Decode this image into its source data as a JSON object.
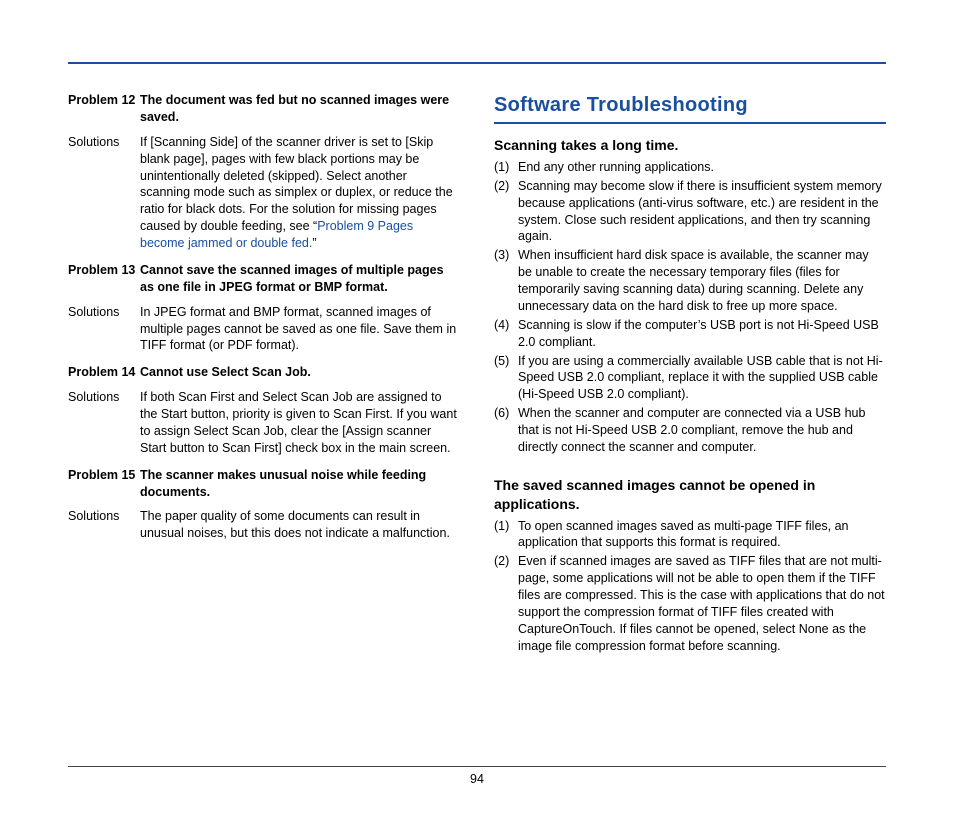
{
  "page_number": "94",
  "left": {
    "items": [
      {
        "label": "Problem 12",
        "title": "The document was fed but no scanned images were saved.",
        "sol_label": "Solutions",
        "sol_pre": "If [Scanning Side] of the scanner driver is set to [Skip blank page], pages with few black portions may be unintentionally deleted (skipped). Select another scanning mode such as simplex or duplex, or reduce the ratio for black dots. For the solution for missing pages caused by double feeding, see “",
        "sol_link": "Problem 9 Pages become jammed or double fed.",
        "sol_post": "”"
      },
      {
        "label": "Problem 13",
        "title": "Cannot save the scanned images of multiple pages as one file in JPEG format or BMP format.",
        "sol_label": "Solutions",
        "sol_body": "In JPEG format and BMP format, scanned images of multiple pages cannot be saved as one file. Save them in TIFF format (or PDF format)."
      },
      {
        "label": "Problem 14",
        "title": "Cannot use Select Scan Job.",
        "sol_label": "Solutions",
        "sol_body": "If both Scan First and Select Scan Job are assigned to the Start button, priority is given to Scan First. If you want to assign Select Scan Job, clear the [Assign scanner Start button to Scan First] check box in the main screen."
      },
      {
        "label": "Problem 15",
        "title": "The scanner makes unusual noise while feeding documents.",
        "sol_label": "Solutions",
        "sol_body": "The paper quality of some documents can result in unusual noises, but this does not indicate a malfunction."
      }
    ]
  },
  "right": {
    "heading": "Software Troubleshooting",
    "sections": [
      {
        "sub": "Scanning takes a long time.",
        "list": [
          {
            "n": "(1)",
            "t": "End any other running applications."
          },
          {
            "n": "(2)",
            "t": "Scanning may become slow if there is insufficient system memory because applications (anti-virus software, etc.) are resident in the system. Close such resident applications, and then try scanning again."
          },
          {
            "n": "(3)",
            "t": "When insufficient hard disk space is available, the scanner may be unable to create the necessary temporary files (files for temporarily saving scanning data) during scanning. Delete any unnecessary data on the hard disk to free up more space."
          },
          {
            "n": "(4)",
            "t": "Scanning is slow if the computer’s USB port is not Hi-Speed USB 2.0 compliant."
          },
          {
            "n": "(5)",
            "t": "If you are using a commercially available USB cable that is not Hi-Speed USB 2.0 compliant, replace it with the supplied USB cable (Hi-Speed USB 2.0 compliant)."
          },
          {
            "n": "(6)",
            "t": "When the scanner and computer are connected via a USB hub that is not Hi-Speed USB 2.0 compliant, remove the hub and directly connect the scanner and computer."
          }
        ]
      },
      {
        "sub": "The saved scanned images cannot be opened in applications.",
        "list": [
          {
            "n": "(1)",
            "t": "To open scanned images saved as multi-page TIFF files, an application that supports this format is required."
          },
          {
            "n": "(2)",
            "t": "Even if scanned images are saved as TIFF files that are not multi-page, some applications will not be able to open them if the TIFF files are compressed. This is the case with applications that do not support the compression format of TIFF files created with CaptureOnTouch. If files cannot be opened, select None as the image file compression format before scanning."
          }
        ]
      }
    ]
  }
}
